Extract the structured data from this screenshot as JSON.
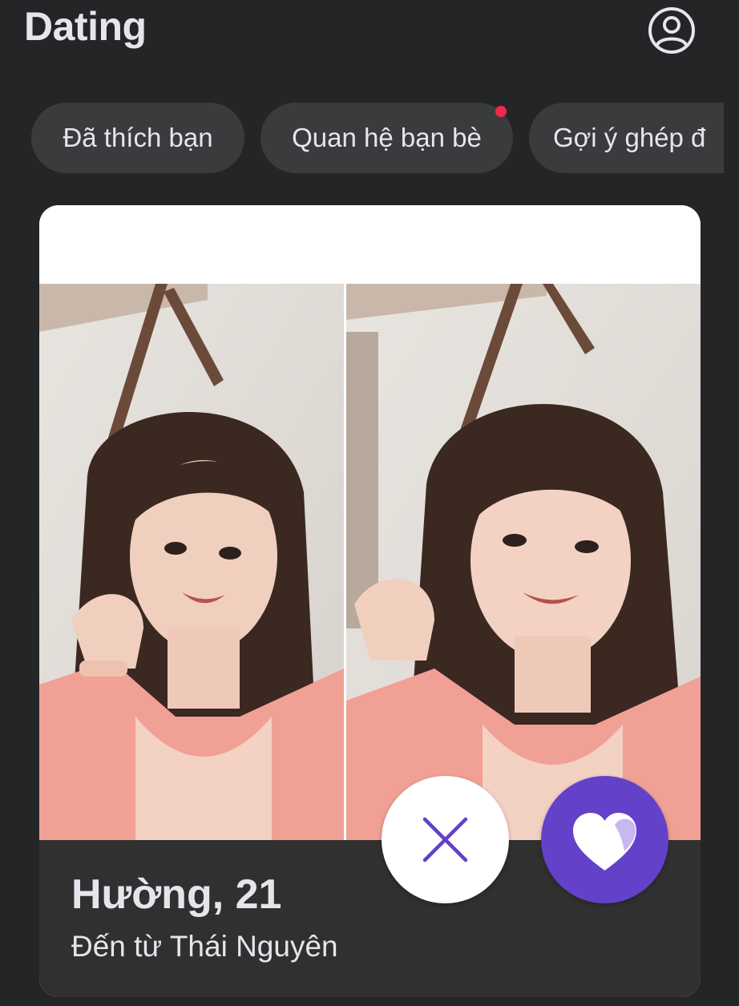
{
  "header": {
    "title": "Dating",
    "profile_icon": "person-circle-icon"
  },
  "filters": {
    "chips": [
      {
        "label": "Đã thích bạn",
        "has_notification": false
      },
      {
        "label": "Quan hệ bạn bè",
        "has_notification": true
      },
      {
        "label": "Gợi ý ghép đ",
        "has_notification": false
      }
    ]
  },
  "profile_card": {
    "name_age": "Hường, 21",
    "location": "Đến từ Thái Nguyên",
    "photo_count": 2
  },
  "actions": {
    "pass_icon": "close-icon",
    "like_icon": "heart-icon"
  },
  "colors": {
    "background": "#242526",
    "chip_background": "#3a3b3c",
    "notification_dot": "#f0284a",
    "like_accent": "#6441c9",
    "card_info_background": "#303031"
  }
}
